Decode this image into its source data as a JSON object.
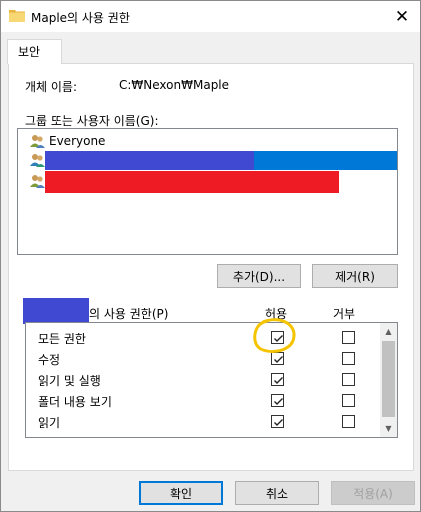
{
  "window": {
    "title": "Maple의 사용 권한",
    "close_glyph": "✕"
  },
  "tabs": [
    {
      "label": "보안"
    }
  ],
  "object_name": {
    "label": "개체 이름:",
    "value": "C:₩Nexon₩Maple"
  },
  "groups": {
    "label": "그룹 또는 사용자 이름(G):",
    "items": [
      {
        "label": "Everyone",
        "icon": "users-icon",
        "redacted": false
      },
      {
        "label": "",
        "icon": "users-icon",
        "redacted": true,
        "selected": true
      },
      {
        "label": "",
        "icon": "users-icon",
        "redacted": true
      }
    ]
  },
  "buttons": {
    "add": "추가(D)...",
    "remove": "제거(R)",
    "ok": "확인",
    "cancel": "취소",
    "apply": "적용(A)"
  },
  "permissions": {
    "title_suffix": "의 사용 권한(P)",
    "allow_header": "허용",
    "deny_header": "거부",
    "rows": [
      {
        "label": "모든 권한",
        "allow": true,
        "deny": false
      },
      {
        "label": "수정",
        "allow": true,
        "deny": false
      },
      {
        "label": "읽기 및 실행",
        "allow": true,
        "deny": false
      },
      {
        "label": "폴더 내용 보기",
        "allow": true,
        "deny": false
      },
      {
        "label": "읽기",
        "allow": true,
        "deny": false
      }
    ]
  },
  "colors": {
    "redaction_blue": "#3f49d1",
    "redaction_red": "#ee1b24",
    "selection": "#0078d7",
    "annotation": "#f5c400"
  }
}
